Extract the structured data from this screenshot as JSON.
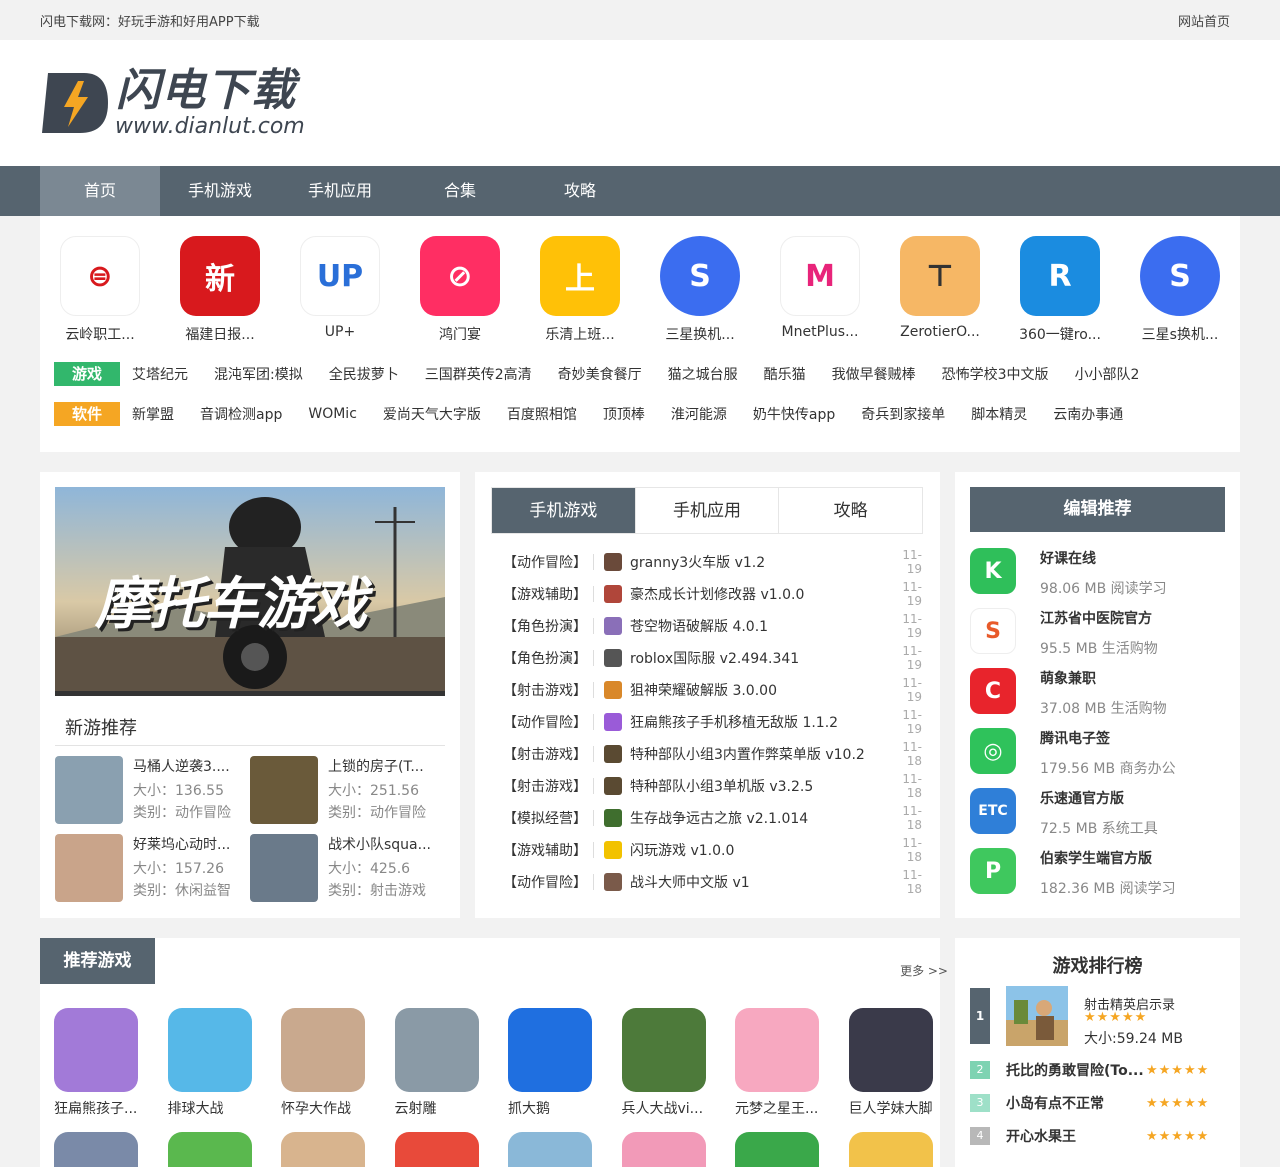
{
  "topbar": {
    "tagline": "闪电下载网：好玩手游和好用APP下载",
    "home_link": "网站首页"
  },
  "logo": {
    "title": "闪电下载",
    "url": "www.dianlut.com"
  },
  "nav": [
    {
      "label": "首页",
      "active": true
    },
    {
      "label": "手机游戏",
      "active": false
    },
    {
      "label": "手机应用",
      "active": false
    },
    {
      "label": "合集",
      "active": false
    },
    {
      "label": "攻略",
      "active": false
    }
  ],
  "apps": [
    {
      "label": "云岭职工...",
      "icon": "seal-icon",
      "color": "#ffffff"
    },
    {
      "label": "福建日报...",
      "icon": "newspaper-icon",
      "color": "#d8191d"
    },
    {
      "label": "UP+",
      "icon": "up-plus-icon",
      "color": "#ffffff"
    },
    {
      "label": "鸿门宴",
      "icon": "slashed-icon",
      "color": "#ff2e63"
    },
    {
      "label": "乐清上班...",
      "icon": "commute-icon",
      "color": "#ffc107"
    },
    {
      "label": "三星换机...",
      "icon": "smart-switch-icon",
      "color": "#3b6df0"
    },
    {
      "label": "MnetPlus...",
      "icon": "mnet-icon",
      "color": "#ffffff"
    },
    {
      "label": "ZerotierO...",
      "icon": "zerotier-icon",
      "color": "#f6b765"
    },
    {
      "label": "360一键ro...",
      "icon": "root-r-icon",
      "color": "#1b8ce0"
    },
    {
      "label": "三星s换机...",
      "icon": "smart-switch-icon",
      "color": "#3b6df0"
    }
  ],
  "tags": {
    "game_label": "游戏",
    "game_links": [
      "艾塔纪元",
      "混沌军团:模拟",
      "全民拔萝卜",
      "三国群英传2高清",
      "奇妙美食餐厅",
      "猫之城台服",
      "酷乐猫",
      "我做早餐贼棒",
      "恐怖学校3中文版",
      "小小部队2"
    ],
    "soft_label": "软件",
    "soft_links": [
      "新掌盟",
      "音调检测app",
      "WOMic",
      "爱尚天气大字版",
      "百度照相馆",
      "顶顶棒",
      "淮河能源",
      "奶牛快传app",
      "奇兵到家接单",
      "脚本精灵",
      "云南办事通"
    ]
  },
  "banner": {
    "text": "摩托车游戏"
  },
  "new_games": {
    "title": "新游推荐",
    "items": [
      {
        "name": "马桶人逆袭3....",
        "size": "大小：136.55",
        "category": "类别：动作冒险"
      },
      {
        "name": "上锁的房子(T...",
        "size": "大小：251.56",
        "category": "类别：动作冒险"
      },
      {
        "name": "好莱坞心动时...",
        "size": "大小：157.26",
        "category": "类别：休闲益智"
      },
      {
        "name": "战术小队squa...",
        "size": "大小：425.6",
        "category": "类别：射击游戏"
      }
    ]
  },
  "list_tabs": [
    {
      "label": "手机游戏",
      "active": true
    },
    {
      "label": "手机应用",
      "active": false
    },
    {
      "label": "攻略",
      "active": false
    }
  ],
  "list_items": [
    {
      "category": "【动作冒险】",
      "name": "granny3火车版 v1.2",
      "date": "11-19",
      "color": "#6a4a3a"
    },
    {
      "category": "【游戏辅助】",
      "name": "豪杰成长计划修改器 v1.0.0",
      "date": "11-19",
      "color": "#b0463a"
    },
    {
      "category": "【角色扮演】",
      "name": "苍空物语破解版 4.0.1",
      "date": "11-19",
      "color": "#8a6fb8"
    },
    {
      "category": "【角色扮演】",
      "name": "roblox国际服 v2.494.341",
      "date": "11-19",
      "color": "#555555"
    },
    {
      "category": "【射击游戏】",
      "name": "狙神荣耀破解版 3.0.00",
      "date": "11-19",
      "color": "#d9882a"
    },
    {
      "category": "【动作冒险】",
      "name": "狂扁熊孩子手机移植无敌版 1.1.2",
      "date": "11-19",
      "color": "#9a5bd8"
    },
    {
      "category": "【射击游戏】",
      "name": "特种部队小组3内置作弊菜单版 v10.2",
      "date": "11-18",
      "color": "#5a4a32"
    },
    {
      "category": "【射击游戏】",
      "name": "特种部队小组3单机版 v3.2.5",
      "date": "11-18",
      "color": "#5a4a32"
    },
    {
      "category": "【模拟经营】",
      "name": "生存战争远古之旅 v2.1.014",
      "date": "11-18",
      "color": "#3f6e2e"
    },
    {
      "category": "【游戏辅助】",
      "name": "闪玩游戏 v1.0.0",
      "date": "11-18",
      "color": "#f2c200"
    },
    {
      "category": "【动作冒险】",
      "name": "战斗大师中文版 v1",
      "date": "11-18",
      "color": "#7a5a4a"
    }
  ],
  "editor_pick": {
    "title": "编辑推荐",
    "items": [
      {
        "name": "好课在线",
        "meta": "98.06 MB  阅读学习",
        "color": "#2fbf5a",
        "icon": "k-icon"
      },
      {
        "name": "江苏省中医院官方",
        "meta": "95.5 MB  生活购物",
        "color": "#ffffff",
        "icon": "hospital-icon"
      },
      {
        "name": "萌象兼职",
        "meta": "37.08 MB  生活购物",
        "color": "#e8242c",
        "icon": "elephant-icon"
      },
      {
        "name": "腾讯电子签",
        "meta": "179.56 MB  商务办公",
        "color": "#2fc25b",
        "icon": "wechat-icon"
      },
      {
        "name": "乐速通官方版",
        "meta": "72.5 MB  系统工具",
        "color": "#2f7fd8",
        "icon": "etc-icon"
      },
      {
        "name": "伯索学生端官方版",
        "meta": "182.36 MB  阅读学习",
        "color": "#3fc85e",
        "icon": "p-icon"
      }
    ]
  },
  "rec_games": {
    "title": "推荐游戏",
    "more": "更多 >>",
    "items": [
      {
        "label": "狂扁熊孩子...",
        "color": "#a27ad8"
      },
      {
        "label": "排球大战",
        "color": "#56b8e8"
      },
      {
        "label": "怀孕大作战",
        "color": "#c9a98e"
      },
      {
        "label": "云射雕",
        "color": "#8a9aa6"
      },
      {
        "label": "抓大鹅",
        "color": "#1f6fe0"
      },
      {
        "label": "兵人大战vi...",
        "color": "#4d7a3a"
      },
      {
        "label": "元梦之星王...",
        "color": "#f7a8c0"
      },
      {
        "label": "巨人学妹大脚",
        "color": "#3a3a4a"
      }
    ],
    "row2_colors": [
      "#7a8aa8",
      "#5ab84e",
      "#d8b48e",
      "#e84a3a",
      "#8ab8d8",
      "#f29ab8",
      "#3aa84a",
      "#f2c24a"
    ]
  },
  "ranking": {
    "title": "游戏排行榜",
    "top": {
      "rank": "1",
      "name": "射击精英启示录",
      "stars": "★★★★★",
      "size": "大小:59.24 MB"
    },
    "rows": [
      {
        "rank": "2",
        "name": "托比的勇敢冒险(To...",
        "stars": "★★★★★",
        "color": "#7ed3b2"
      },
      {
        "rank": "3",
        "name": "小岛有点不正常",
        "stars": "★★★★★",
        "color": "#9ee0c8"
      },
      {
        "rank": "4",
        "name": "开心水果王",
        "stars": "★★★★★",
        "color": "#b8b8b8"
      }
    ]
  }
}
